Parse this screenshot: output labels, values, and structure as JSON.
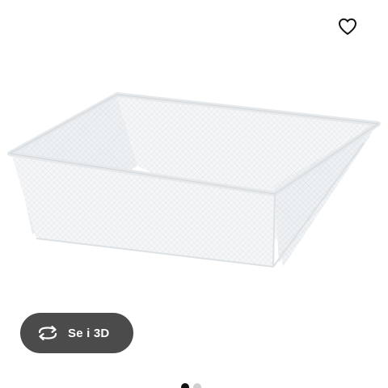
{
  "product": {
    "image_icon": "wire-mesh-basket-image"
  },
  "favorite": {
    "icon": "heart-outline-icon"
  },
  "view3d": {
    "icon": "rotate-arrows-icon",
    "label": "Se i 3D",
    "bg_color": "#4b4b4b"
  },
  "carousel": {
    "total": 2,
    "active_index": 1
  }
}
